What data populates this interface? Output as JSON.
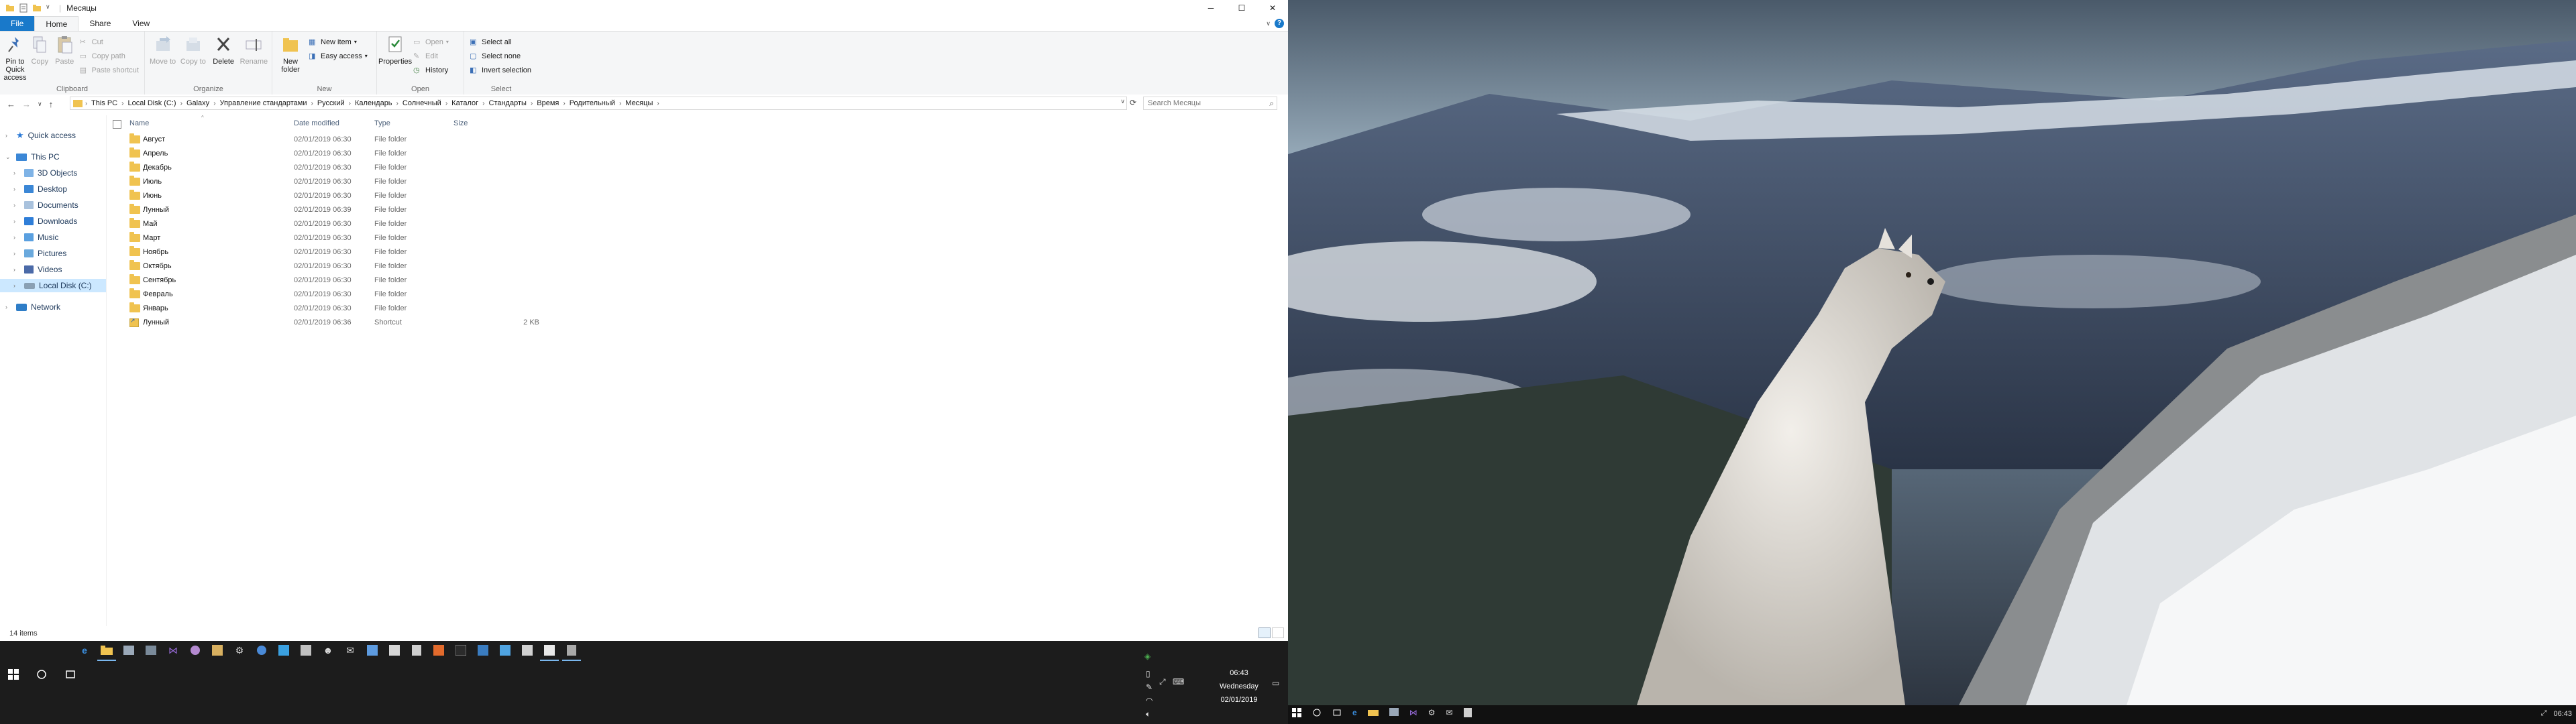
{
  "window": {
    "title": "Месяцы",
    "controls": {
      "minimize": "─",
      "maximize": "☐",
      "close": "✕"
    }
  },
  "tabs": [
    "File",
    "Home",
    "Share",
    "View"
  ],
  "ribbon": {
    "clipboard": {
      "label": "Clipboard",
      "pin": "Pin to Quick access",
      "copy": "Copy",
      "paste": "Paste",
      "cut": "Cut",
      "copy_path": "Copy path",
      "paste_shortcut": "Paste shortcut"
    },
    "organize": {
      "label": "Organize",
      "move_to": "Move to",
      "copy_to": "Copy to",
      "delete": "Delete",
      "rename": "Rename"
    },
    "new": {
      "label": "New",
      "new_folder": "New folder",
      "new_item": "New item",
      "easy_access": "Easy access"
    },
    "open": {
      "label": "Open",
      "properties": "Properties",
      "open": "Open",
      "edit": "Edit",
      "history": "History"
    },
    "select": {
      "label": "Select",
      "select_all": "Select all",
      "select_none": "Select none",
      "invert": "Invert selection"
    }
  },
  "address": {
    "crumbs": [
      "This PC",
      "Local Disk (C:)",
      "Galaxy",
      "Управление стандартами",
      "Русский",
      "Календарь",
      "Солнечный",
      "Каталог",
      "Стандарты",
      "Время",
      "Родительный",
      "Месяцы"
    ],
    "search_placeholder": "Search Месяцы"
  },
  "nav": {
    "quick_access": "Quick access",
    "this_pc": "This PC",
    "objects3d": "3D Objects",
    "desktop": "Desktop",
    "documents": "Documents",
    "downloads": "Downloads",
    "music": "Music",
    "pictures": "Pictures",
    "videos": "Videos",
    "local_disk": "Local Disk (C:)",
    "network": "Network"
  },
  "columns": {
    "name": "Name",
    "date": "Date modified",
    "type": "Type",
    "size": "Size"
  },
  "files": [
    {
      "name": "Август",
      "date": "02/01/2019 06:30",
      "type": "File folder",
      "size": ""
    },
    {
      "name": "Апрель",
      "date": "02/01/2019 06:30",
      "type": "File folder",
      "size": ""
    },
    {
      "name": "Декабрь",
      "date": "02/01/2019 06:30",
      "type": "File folder",
      "size": ""
    },
    {
      "name": "Июль",
      "date": "02/01/2019 06:30",
      "type": "File folder",
      "size": ""
    },
    {
      "name": "Июнь",
      "date": "02/01/2019 06:30",
      "type": "File folder",
      "size": ""
    },
    {
      "name": "Лунный",
      "date": "02/01/2019 06:39",
      "type": "File folder",
      "size": ""
    },
    {
      "name": "Май",
      "date": "02/01/2019 06:30",
      "type": "File folder",
      "size": ""
    },
    {
      "name": "Март",
      "date": "02/01/2019 06:30",
      "type": "File folder",
      "size": ""
    },
    {
      "name": "Ноябрь",
      "date": "02/01/2019 06:30",
      "type": "File folder",
      "size": ""
    },
    {
      "name": "Октябрь",
      "date": "02/01/2019 06:30",
      "type": "File folder",
      "size": ""
    },
    {
      "name": "Сентябрь",
      "date": "02/01/2019 06:30",
      "type": "File folder",
      "size": ""
    },
    {
      "name": "Февраль",
      "date": "02/01/2019 06:30",
      "type": "File folder",
      "size": ""
    },
    {
      "name": "Январь",
      "date": "02/01/2019 06:30",
      "type": "File folder",
      "size": ""
    },
    {
      "name": "Лунный",
      "date": "02/01/2019 06:36",
      "type": "Shortcut",
      "size": "2 KB"
    }
  ],
  "status": {
    "items": "14 items"
  },
  "taskbar": {
    "time": "06:43",
    "day": "Wednesday",
    "date": "02/01/2019",
    "right_time": "06:43"
  },
  "colors": {
    "accent": "#1979ca",
    "folder": "#f0c350",
    "taskbar": "#1c1c1c"
  }
}
